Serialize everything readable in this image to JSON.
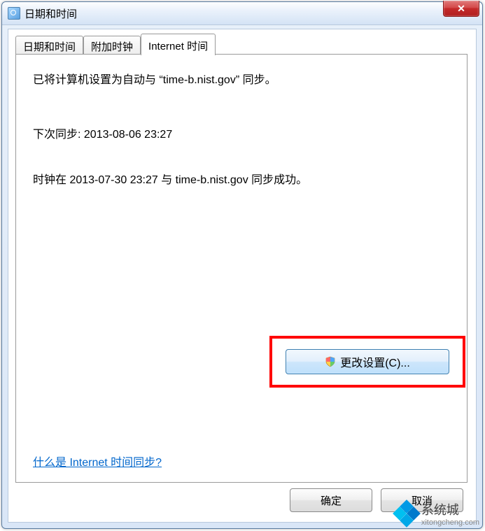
{
  "window": {
    "title": "日期和时间"
  },
  "tabs": {
    "t0": "日期和时间",
    "t1": "附加时钟",
    "t2": "Internet 时间"
  },
  "content": {
    "sync_config": "已将计算机设置为自动与 “time-b.nist.gov” 同步。",
    "next_sync": "下次同步: 2013-08-06 23:27",
    "last_sync": "时钟在 2013-07-30 23:27 与 time-b.nist.gov 同步成功。",
    "change_button": "更改设置(C)...",
    "help_link": "什么是 Internet 时间同步?"
  },
  "buttons": {
    "ok": "确定",
    "cancel": "取消"
  },
  "watermark": {
    "brand": "系统城",
    "url": "xitongcheng.com"
  }
}
